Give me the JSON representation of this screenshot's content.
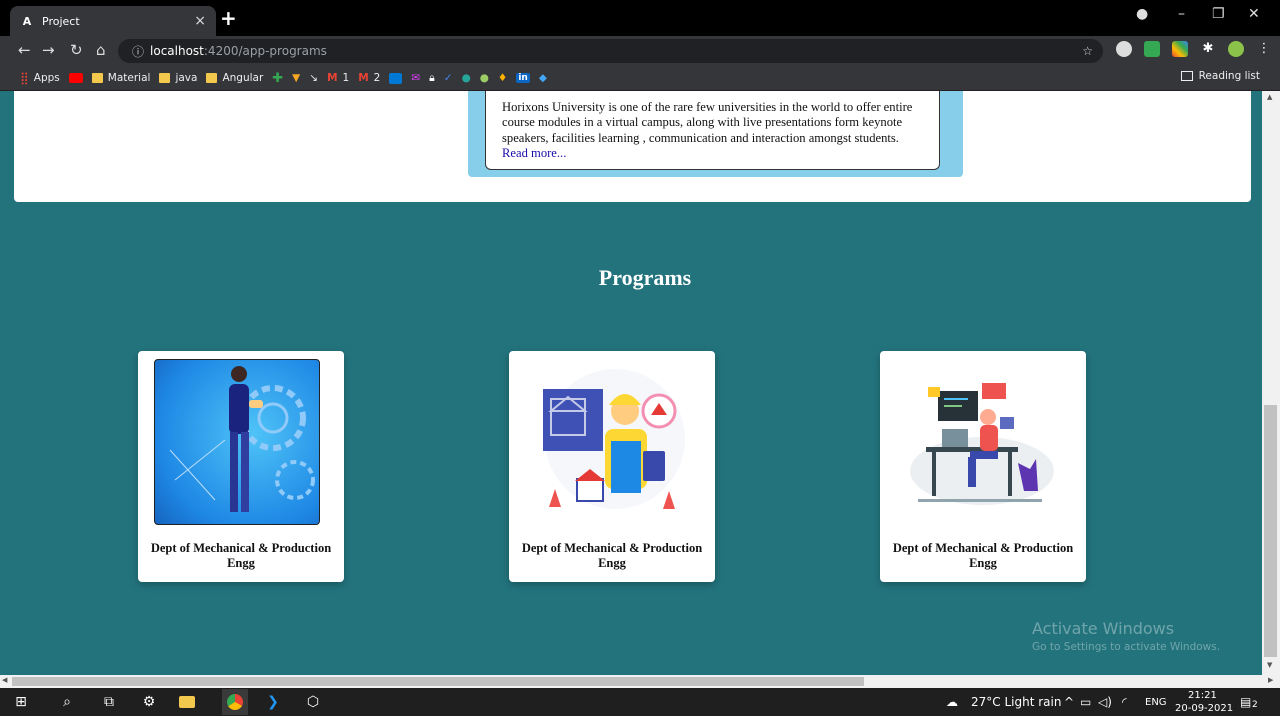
{
  "browser": {
    "tab_title": "Project",
    "tab_favicon": "A",
    "tab_close": "×",
    "new_tab": "+",
    "url_host": "localhost",
    "url_path": ":4200/app-programs",
    "info_icon": "ⓘ",
    "bookmarks": [
      {
        "label": "Apps",
        "icon": "apps-grid-icon"
      },
      {
        "label": "",
        "icon": "youtube-icon"
      },
      {
        "label": "Material",
        "icon": "folder-icon"
      },
      {
        "label": "java",
        "icon": "folder-icon"
      },
      {
        "label": "Angular",
        "icon": "folder-icon"
      },
      {
        "label": "",
        "icon": "plus-green-icon"
      },
      {
        "label": "",
        "icon": "vue-icon"
      },
      {
        "label": "",
        "icon": "pen-icon"
      },
      {
        "label": "1",
        "icon": "gmail-icon"
      },
      {
        "label": "2",
        "icon": "gmail-icon"
      },
      {
        "label": "",
        "icon": "outlook-icon"
      },
      {
        "label": "",
        "icon": "mail-icon"
      },
      {
        "label": "",
        "icon": "lock-icon"
      },
      {
        "label": "",
        "icon": "check-icon"
      },
      {
        "label": "",
        "icon": "globe-icon"
      },
      {
        "label": "",
        "icon": "leaf-icon"
      },
      {
        "label": "",
        "icon": "drop-icon"
      },
      {
        "label": "",
        "icon": "linkedin-icon"
      },
      {
        "label": "",
        "icon": "diamond-icon"
      }
    ],
    "reading_list": "Reading list"
  },
  "about": {
    "text": "Horixons University is one of the rare few universities in the world to offer entire course modules in a virtual campus, along with live presentations form keynote speakers, facilities learning , communication and interaction amongst students.",
    "link": "Read more..."
  },
  "programs": {
    "title": "Programs",
    "cards": [
      {
        "caption": "Dept of Mechanical & Production Engg",
        "image": "engineer-gears-illustration"
      },
      {
        "caption": "Dept of Mechanical & Production Engg",
        "image": "construction-worker-illustration"
      },
      {
        "caption": "Dept of Mechanical & Production Engg",
        "image": "programmer-desk-illustration"
      }
    ]
  },
  "watermark": {
    "line1": "Activate Windows",
    "line2": "Go to Settings to activate Windows."
  },
  "taskbar": {
    "weather": "27°C  Light rain",
    "lang": "ENG",
    "time": "21:21",
    "date": "20-09-2021",
    "notifications": "2"
  },
  "colors": {
    "page_bg": "#23737d",
    "panel": "#87ceeb",
    "link": "#1a0dab"
  }
}
